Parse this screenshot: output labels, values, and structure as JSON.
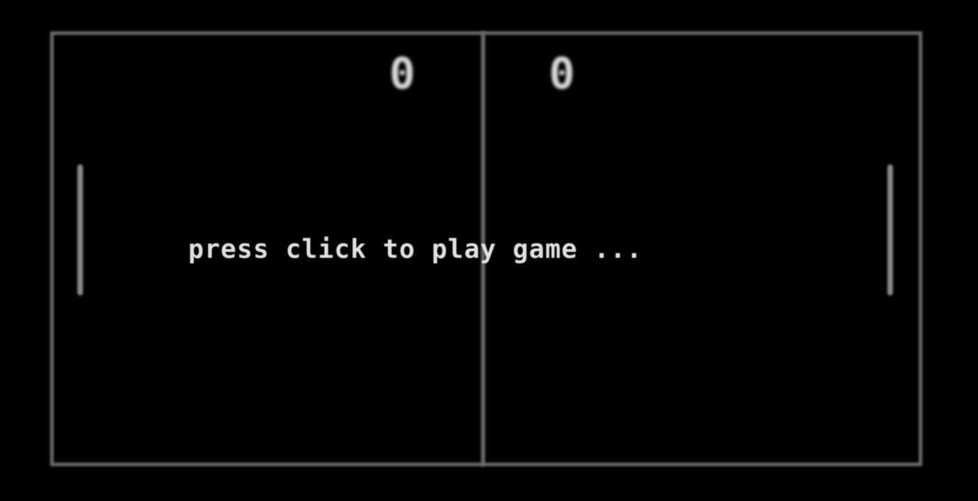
{
  "score": {
    "left": "0",
    "right": "0"
  },
  "message": {
    "prompt": "press click to play game ..."
  },
  "colors": {
    "background": "#000000",
    "court_lines": "#6a6a6a",
    "paddles": "#8a8a8a",
    "text": "#e2e2e2"
  }
}
